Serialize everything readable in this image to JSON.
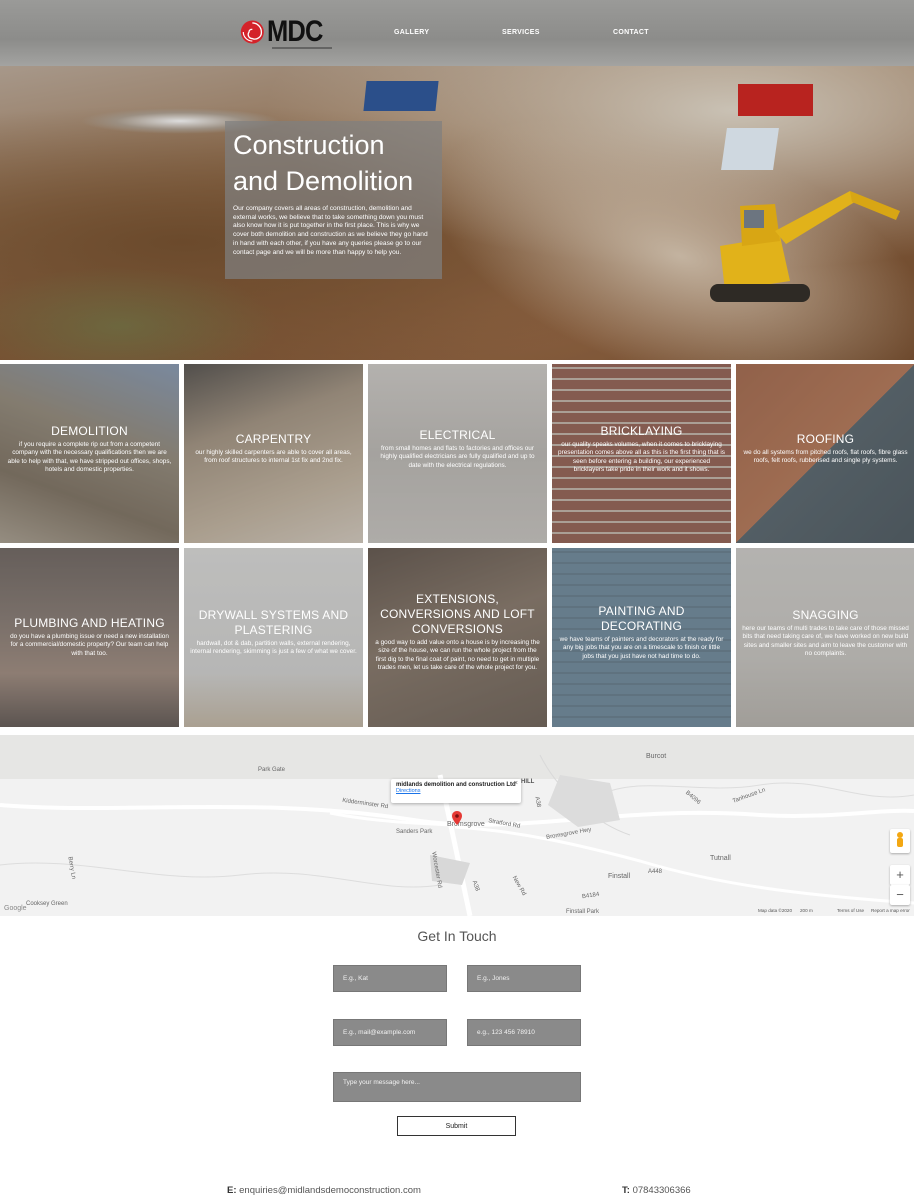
{
  "header": {
    "logo_text": "MDC",
    "nav": [
      {
        "label": "GALLERY"
      },
      {
        "label": "SERVICES"
      },
      {
        "label": "CONTACT"
      }
    ]
  },
  "hero": {
    "title": "Construction and Demolition",
    "text": "Our company covers all areas of construction, demolition and external works, we believe that to take something down you must also know how it is put together in the first place. This is why we cover both demolition and construction as we believe they go hand in hand with each other, if you have any queries please go to our contact page and we will be more than happy to help you."
  },
  "services": [
    {
      "title": "DEMOLITION",
      "text": "if you require a complete rip out from a competent company with the necessary qualifications then we are able to help with that, we have stripped out offices, shops, hotels and domestic properties."
    },
    {
      "title": "CARPENTRY",
      "text": "our highly skilled carpenters are able to cover all areas, from roof structures to internal 1st fix and 2nd fix."
    },
    {
      "title": "ELECTRICAL",
      "text": "from small homes and flats to factories and offices our highly qualified electricians are fully qualified and up to date with the electrical regulations."
    },
    {
      "title": "BRICKLAYING",
      "text": "our quality speaks volumes, when it comes to bricklaying presentation comes above all as this is the first thing that is seen before entering a building, our experienced bricklayers take pride in their work and it shows."
    },
    {
      "title": "ROOFING",
      "text": "we do all systems from pitched roofs, flat roofs, fibre glass roofs, felt roofs, rubberised and single ply systems."
    },
    {
      "title": "PLUMBING AND HEATING",
      "text": "do you have a plumbing issue or need a new installation for a commercial/domestic property? Our team can help with that too."
    },
    {
      "title": "DRYWALL SYSTEMS AND PLASTERING",
      "text": "hardwall, dot & dab, partition walls, external rendering, internal rendering, skimming is just a few of what we cover."
    },
    {
      "title": "EXTENSIONS, CONVERSIONS AND LOFT CONVERSIONS",
      "text": "a good way to add value onto a house is by increasing the size of the house, we can run the whole project from the first dig to the final coat of paint, no need to get in multiple trades men, let us take care of the whole project for you."
    },
    {
      "title": "PAINTING AND DECORATING",
      "text": "we have teams of painters and decorators at the ready for any big jobs that you are on a timescale to finish or little jobs that you just have not had time to do."
    },
    {
      "title": "SNAGGING",
      "text": "here our teams of multi trades to take care of those missed bits that need taking care of, we have worked on new build sites and smaller sites and aim to leave the customer with no complaints."
    }
  ],
  "map": {
    "info_name": "midlands demolition and construction Ltd",
    "info_directions": "Directions",
    "close": "×",
    "hill_label": "HILL",
    "places": [
      "Burcot",
      "Park Gate",
      "Kidderminster Rd",
      "Sanders Park",
      "Bromsgrove",
      "Stratford Rd",
      "Bromsgrove Hwy",
      "Tutnall",
      "Finstall",
      "A448",
      "B4184",
      "Finstall Park",
      "A38",
      "B4096",
      "Cooksey Green",
      "Worcester Rd",
      "A38",
      "New Rd",
      "Berry Ln",
      "Tanhouse Ln"
    ],
    "zoom_in": "+",
    "zoom_out": "−",
    "footer_google": "Google",
    "footer_data": "Map data ©2020",
    "footer_scale": "200 m",
    "footer_terms": "Terms of Use",
    "footer_report": "Report a map error"
  },
  "contact": {
    "heading": "Get In Touch",
    "first_name_placeholder": "E.g., Kat",
    "last_name_placeholder": "E.g., Jones",
    "email_placeholder": "E.g., mail@example.com",
    "phone_placeholder": "e.g., 123 456 78910",
    "message_placeholder": "Type your message here...",
    "submit_label": "Submit"
  },
  "footer": {
    "email_label": "E:",
    "email": "enquiries@midlandsdemoconstruction.com",
    "phone_label": "T:",
    "phone": "07843306366"
  },
  "colors": {
    "logo_red": "#d4232a",
    "field_grey": "#8a8a8a",
    "pin_red": "#e53935"
  }
}
